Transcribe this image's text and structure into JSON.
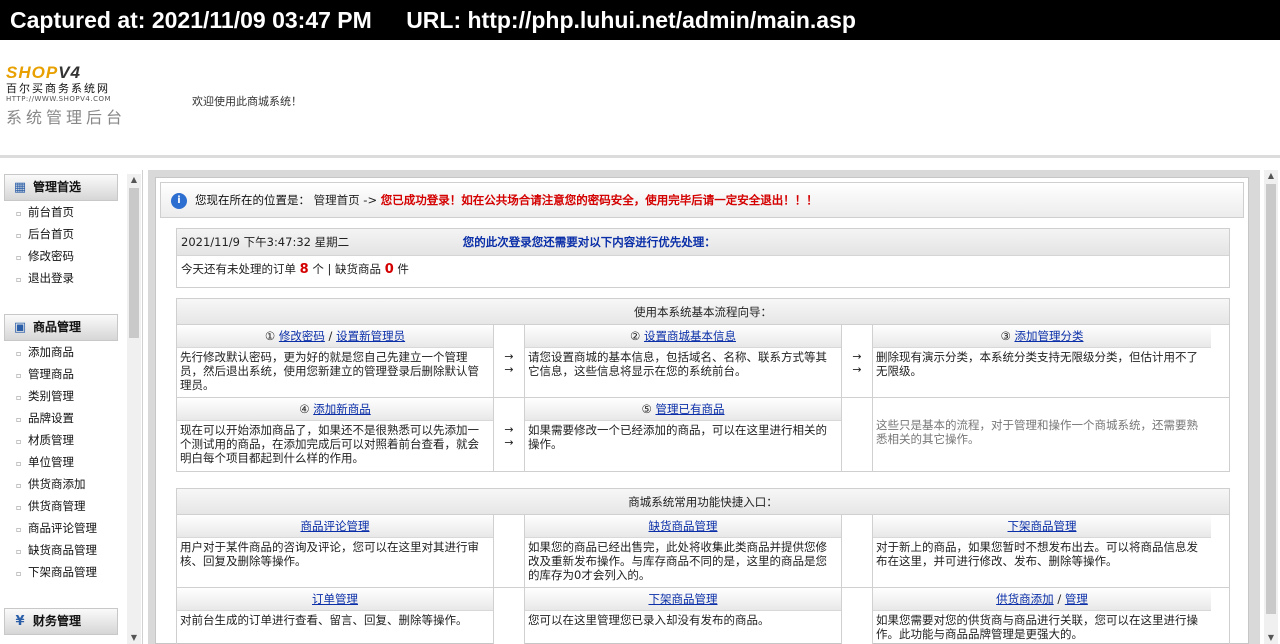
{
  "capture": {
    "time": "Captured at: 2021/11/09 03:47 PM",
    "url": "URL: http://php.luhui.net/admin/main.asp"
  },
  "header": {
    "logo_brand_a": "SHOP",
    "logo_brand_b": "V4",
    "logo_sub": "百尔买商务系统网",
    "logo_url": "HTTP://WWW.SHOPV4.COM",
    "logo_admin": "系统管理后台",
    "welcome": "欢迎使用此商城系统！"
  },
  "sidebar": {
    "groups": [
      {
        "title": "管理首选",
        "items": [
          "前台首页",
          "后台首页",
          "修改密码",
          "退出登录"
        ]
      },
      {
        "title": "商品管理",
        "items": [
          "添加商品",
          "管理商品",
          "类别管理",
          "品牌设置",
          "材质管理",
          "单位管理",
          "供货商添加",
          "供货商管理",
          "商品评论管理",
          "缺货商品管理",
          "下架商品管理"
        ]
      },
      {
        "title": "财务管理",
        "items": []
      }
    ]
  },
  "location": {
    "label": "您现在所在的位置是：",
    "path": "管理首页 ->",
    "warning": "您已成功登录！如在公共场合请注意您的密码安全，使用完毕后请一定安全退出！！！"
  },
  "status": {
    "datetime": "2021/11/9 下午3:47:32 星期二",
    "todo_title": "您的此次登录您还需要对以下内容进行优先处理：",
    "orders_prefix": "今天还有未处理的订单",
    "orders_count": "8",
    "orders_unit": "个 | 缺货商品",
    "stockout_count": "0",
    "stockout_unit": "件"
  },
  "flow": {
    "title": "使用本系统基本流程向导：",
    "arrow": "→",
    "steps": [
      {
        "num": "①",
        "links": [
          "修改密码",
          "设置新管理员"
        ],
        "sep": "/",
        "desc": "先行修改默认密码，更为好的就是您自己先建立一个管理员，然后退出系统，使用您新建立的管理登录后删除默认管理员。"
      },
      {
        "num": "②",
        "links": [
          "设置商城基本信息"
        ],
        "desc": "请您设置商城的基本信息，包括域名、名称、联系方式等其它信息，这些信息将显示在您的系统前台。"
      },
      {
        "num": "③",
        "links": [
          "添加管理分类"
        ],
        "desc": "删除现有演示分类，本系统分类支持无限级分类，但估计用不了无限级。"
      },
      {
        "num": "④",
        "links": [
          "添加新商品"
        ],
        "desc": "现在可以开始添加商品了，如果还不是很熟悉可以先添加一个测试用的商品，在添加完成后可以对照着前台查看，就会明白每个项目都起到什么样的作用。"
      },
      {
        "num": "⑤",
        "links": [
          "管理已有商品"
        ],
        "desc": "如果需要修改一个已经添加的商品，可以在这里进行相关的操作。"
      }
    ],
    "note": "这些只是基本的流程，对于管理和操作一个商城系统，还需要熟悉相关的其它操作。"
  },
  "quick": {
    "title": "商城系统常用功能快捷入口：",
    "items": [
      {
        "links": [
          "商品评论管理"
        ],
        "desc": "用户对于某件商品的咨询及评论，您可以在这里对其进行审核、回复及删除等操作。"
      },
      {
        "links": [
          "缺货商品管理"
        ],
        "desc": "如果您的商品已经出售完，此处将收集此类商品并提供您修改及重新发布操作。与库存商品不同的是，这里的商品是您的库存为0才会列入的。"
      },
      {
        "links": [
          "下架商品管理"
        ],
        "desc": "对于新上的商品，如果您暂时不想发布出去。可以将商品信息发布在这里，并可进行修改、发布、删除等操作。"
      },
      {
        "links": [
          "订单管理"
        ],
        "desc": "对前台生成的订单进行查看、留言、回复、删除等操作。"
      },
      {
        "links": [
          "下架商品管理"
        ],
        "desc": "您可以在这里管理您已录入却没有发布的商品。"
      },
      {
        "links": [
          "供货商添加",
          "管理"
        ],
        "sep": "/",
        "desc": "如果您需要对您的供货商与商品进行关联，您可以在这里进行操作。此功能与商品品牌管理是更强大的。"
      }
    ]
  }
}
